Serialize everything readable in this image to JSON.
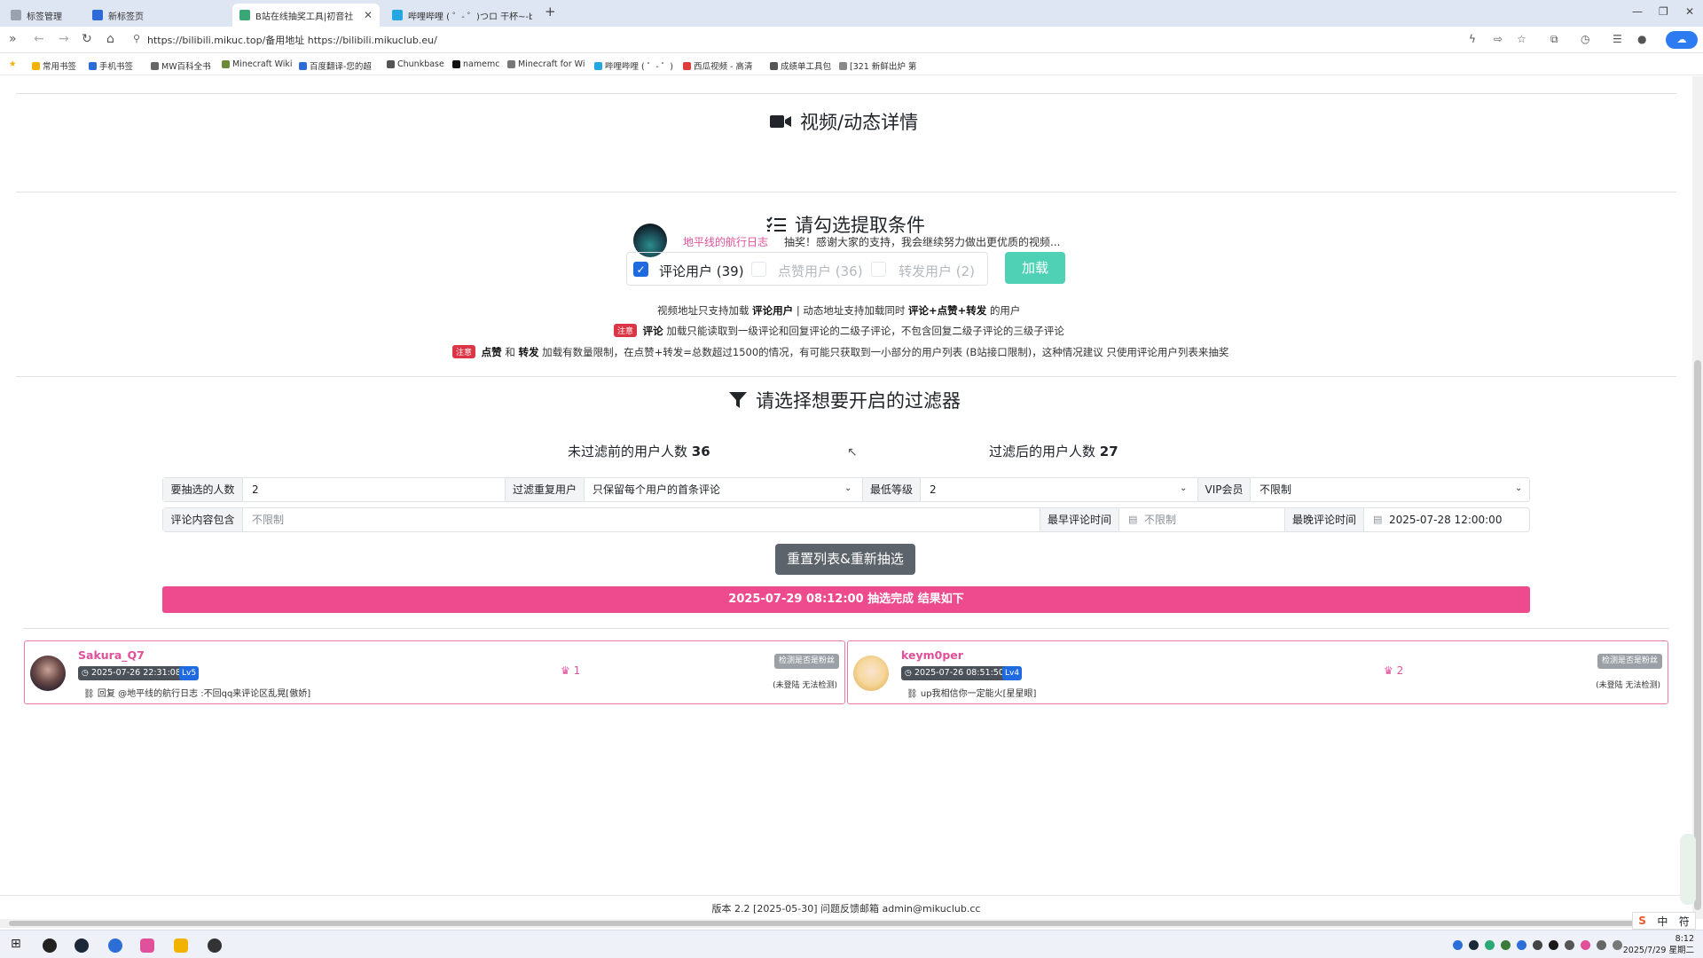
{
  "browser": {
    "tabs": [
      {
        "label": "标签管理",
        "active": false
      },
      {
        "label": "新标签页",
        "active": false
      },
      {
        "label": "B站在线抽奖工具|初音社",
        "active": true
      },
      {
        "label": "哔哩哔哩 ( ゜- ゜)つロ 干杯~-bili",
        "active": false
      }
    ],
    "url": "https://bilibili.mikuc.top/备用地址 https://bilibili.mikuclub.eu/",
    "bookmarks": [
      "常用书签",
      "手机书签",
      "MW百科全书",
      "Minecraft Wiki",
      "百度翻译-您的超",
      "Chunkbase",
      "namemc",
      "Minecraft for Wi",
      "哔哩哔哩 ( ゜- ゜)",
      "西瓜视频 - 高清",
      "成绩单工具包",
      "[321 新鲜出炉 第"
    ]
  },
  "video": {
    "section_title": "视频/动态详情",
    "uploader": "地平线的航行日志",
    "description": "抽奖！感谢大家的支持，我会继续努力做出更优质的视频..."
  },
  "conditions": {
    "section_title": "请勾选提取条件",
    "options": [
      {
        "label": "评论用户 (39)",
        "checked": true
      },
      {
        "label": "点赞用户 (36)",
        "checked": false
      },
      {
        "label": "转发用户 (2)",
        "checked": false
      }
    ],
    "load_button": "加载",
    "note1_pre": "视频地址只支持加载",
    "note1_b1": "评论用户",
    "note1_mid": "| 动态地址支持加载同时",
    "note1_b2": "评论+点赞+转发",
    "note1_post": "的用户",
    "note_badge": "注意",
    "note2_b": "评论",
    "note2_text": "加载只能读取到一级评论和回复评论的二级子评论，不包含回复二级子评论的三级子评论",
    "note3_b1": "点赞",
    "note3_and": "和",
    "note3_b2": "转发",
    "note3_text": "加载有数量限制，在点赞+转发=总数超过1500的情况，有可能只获取到一小部分的用户列表 (B站接口限制)，这种情况建议 只使用评论用户列表来抽奖"
  },
  "filters": {
    "section_title": "请选择想要开启的过滤器",
    "before_label": "未过滤前的用户人数",
    "before_count": "36",
    "after_label": "过滤后的用户人数",
    "after_count": "27",
    "draw_count_label": "要抽选的人数",
    "draw_count_value": "2",
    "dedupe_label": "过滤重复用户",
    "dedupe_value": "只保留每个用户的首条评论",
    "min_level_label": "最低等级",
    "min_level_value": "2",
    "vip_label": "VIP会员",
    "vip_value": "不限制",
    "comment_contains_label": "评论内容包含",
    "comment_contains_placeholder": "不限制",
    "earliest_label": "最早评论时间",
    "earliest_placeholder": "不限制",
    "latest_label": "最晚评论时间",
    "latest_value": "2025-07-28 12:00:00",
    "reset_button": "重置列表&重新抽选"
  },
  "result": {
    "banner": "2025-07-29 08:12:00 抽选完成 结果如下",
    "winners": [
      {
        "name": "Sakura_Q7",
        "time": "2025-07-26 22:31:08",
        "level": "Lv5",
        "comment": "回复 @地平线的航行日志 :不回qq来评论区乱晃[傲娇]",
        "rank": "1",
        "check_button": "检测是否是粉丝",
        "status": "(未登陆 无法检测)"
      },
      {
        "name": "keym0per",
        "time": "2025-07-26 08:51:50",
        "level": "Lv4",
        "comment": "up我相信你一定能火[星星眼]",
        "rank": "2",
        "check_button": "检测是否是粉丝",
        "status": "(未登陆 无法检测)"
      }
    ]
  },
  "footer": {
    "text": "版本 2.2 [2025-05-30]     问题反馈邮箱 admin@mikuclub.cc"
  },
  "ime": {
    "mode": "中",
    "punct": "符"
  },
  "clock": {
    "time": "8:12",
    "date": "2025/7/29 星期二"
  },
  "colors": {
    "accent_pink": "#ee4b8f",
    "name_pink": "#e0509b",
    "load_green": "#4fd1b6",
    "checkbox_blue": "#1f6ae0",
    "reset_gray": "#5c636a"
  }
}
